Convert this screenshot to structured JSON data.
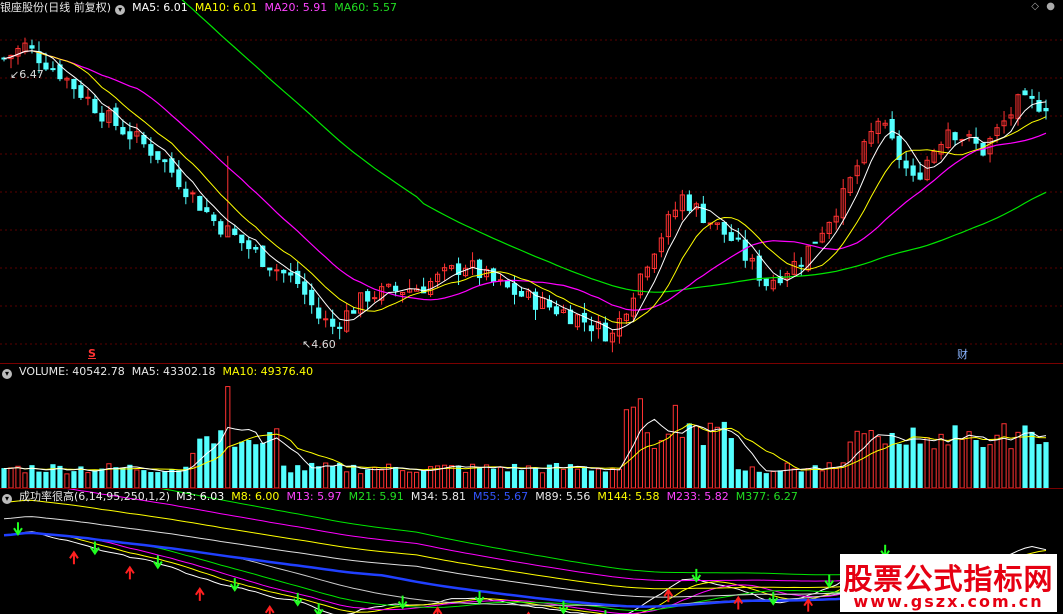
{
  "price_panel": {
    "title": "银座股份(日线 前复权)",
    "ma5": "MA5: 6.01",
    "ma10": "MA10: 6.01",
    "ma20": "MA20: 5.91",
    "ma60": "MA60: 5.57",
    "high_label": "6.47",
    "low_label": "4.60",
    "s_marker": "S",
    "cai_marker": "财",
    "colors": {
      "ma5": "#ffffff",
      "ma10": "#ffff00",
      "ma20": "#ff00ff",
      "ma60": "#00e600",
      "up": "#ff3232",
      "down": "#54ffff"
    }
  },
  "volume_panel": {
    "volume": "VOLUME: 40542.78",
    "ma5": "MA5: 43302.18",
    "ma10": "MA10: 49376.40"
  },
  "indicator_panel": {
    "name": "成功率很高(6,14,95,250,1,2)",
    "m3": "M3: 6.03",
    "m8": "M8: 6.00",
    "m13": "M13: 5.97",
    "m21": "M21: 5.91",
    "m34": "M34: 5.81",
    "m55": "M55: 5.67",
    "m89": "M89: 5.56",
    "m144": "M144: 5.58",
    "m233": "M233: 5.82",
    "m377": "M377: 6.27"
  },
  "watermark": {
    "title": "股票公式指标网",
    "url": "www.gszx.com.cn"
  },
  "chart_data": {
    "type": "candlestick",
    "price_ylim": [
      4.5,
      6.6
    ],
    "price_key_points": [
      {
        "label": "high",
        "value": 6.47
      },
      {
        "label": "low",
        "value": 4.6
      }
    ],
    "ma_last": {
      "MA5": 6.01,
      "MA10": 6.01,
      "MA20": 5.91,
      "MA60": 5.57
    },
    "volume_last": {
      "VOLUME": 40542.78,
      "MA5": 43302.18,
      "MA10": 49376.4
    }
  }
}
